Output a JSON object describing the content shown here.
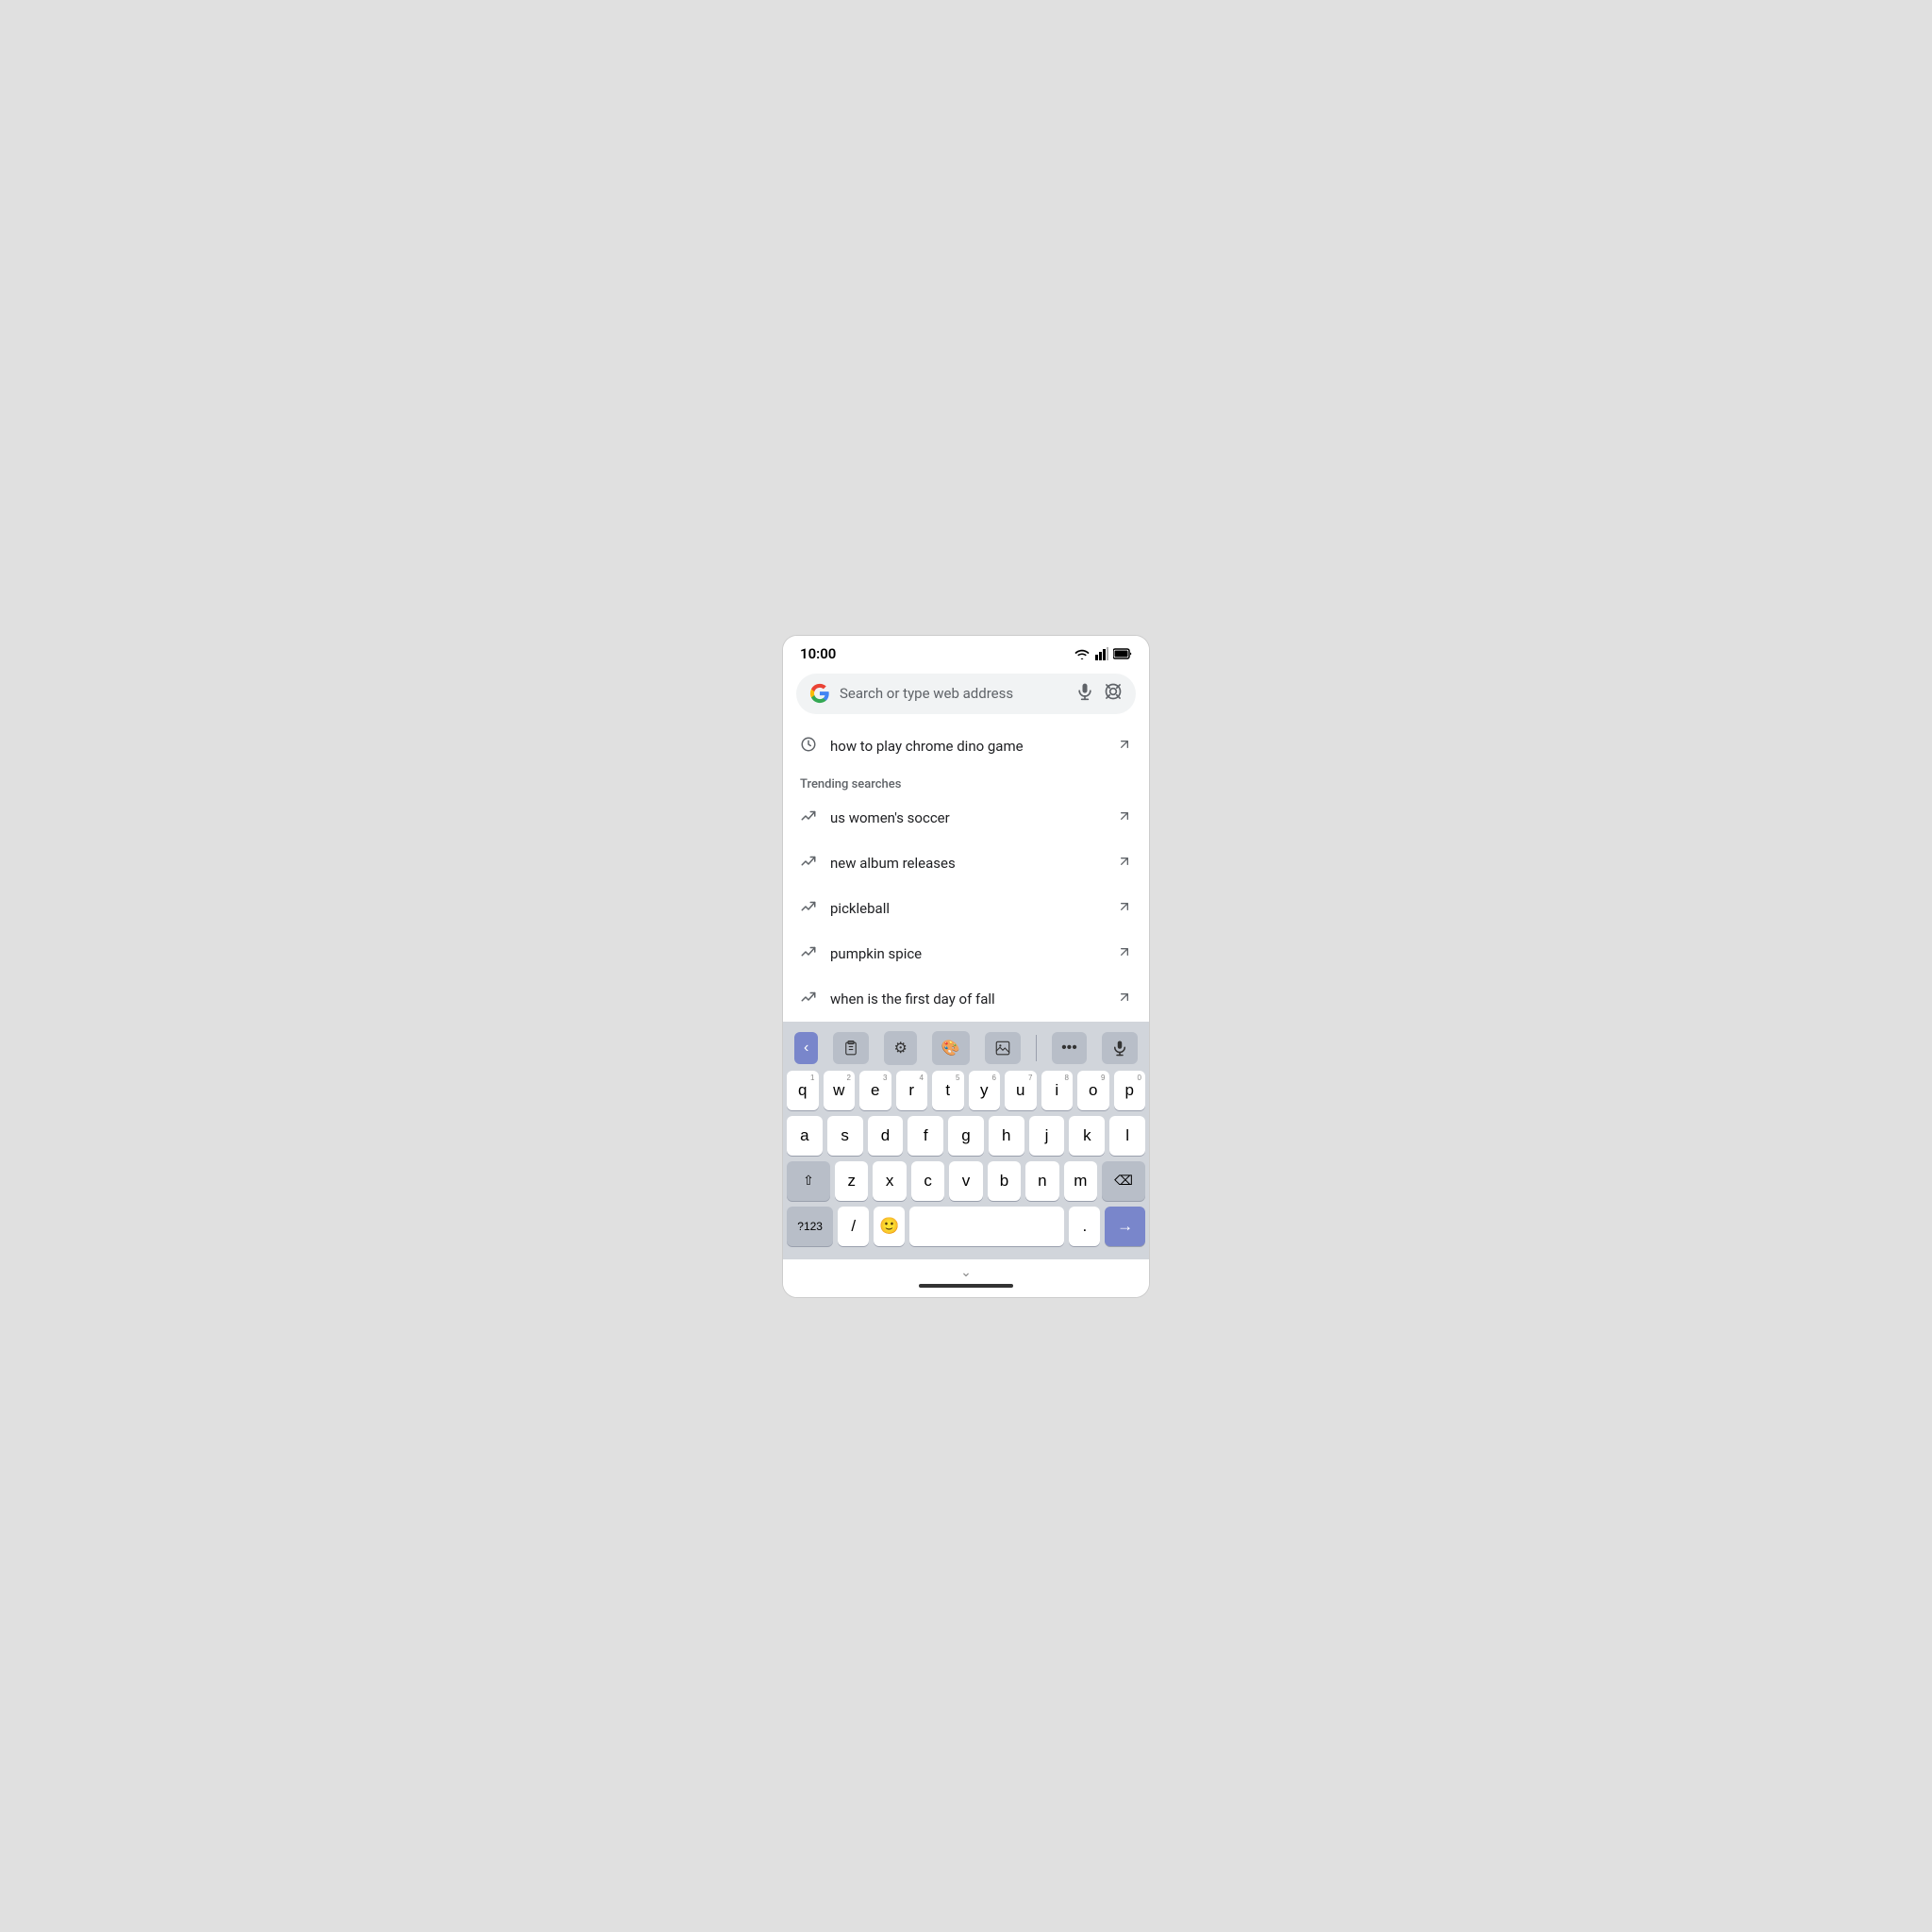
{
  "status": {
    "time": "10:00"
  },
  "search_bar": {
    "placeholder": "Search or type web address"
  },
  "history": [
    {
      "text": "how to play chrome dino game"
    }
  ],
  "trending_section": {
    "label": "Trending searches",
    "items": [
      {
        "text": "us women's soccer"
      },
      {
        "text": "new album releases"
      },
      {
        "text": "pickleball"
      },
      {
        "text": "pumpkin spice"
      },
      {
        "text": "when is the first day of fall"
      }
    ]
  },
  "keyboard": {
    "rows": [
      [
        "q",
        "w",
        "e",
        "r",
        "t",
        "y",
        "u",
        "i",
        "o",
        "p"
      ],
      [
        "a",
        "s",
        "d",
        "f",
        "g",
        "h",
        "j",
        "k",
        "l"
      ],
      [
        "z",
        "x",
        "c",
        "v",
        "b",
        "n",
        "m"
      ]
    ],
    "numbers": [
      "1",
      "2",
      "3",
      "4",
      "5",
      "6",
      "7",
      "8",
      "9",
      "0"
    ],
    "sym_label": "?123",
    "slash_label": "/",
    "period_label": ".",
    "space_label": ""
  }
}
